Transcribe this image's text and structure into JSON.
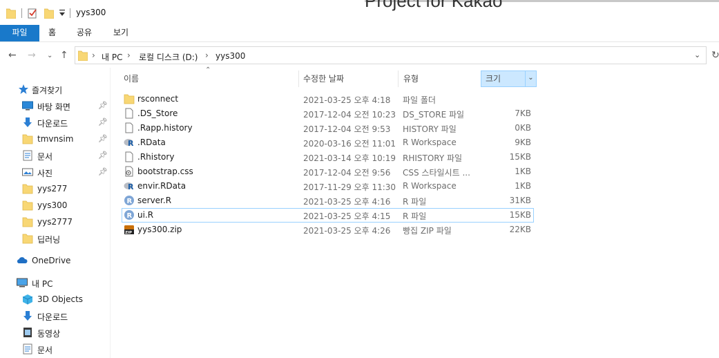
{
  "window": {
    "title": "yys300",
    "background_text": "Project for Kakao"
  },
  "ribbon": {
    "tabs": [
      "파일",
      "홈",
      "공유",
      "보기"
    ]
  },
  "address": {
    "crumbs": [
      "내 PC",
      "로컬 디스크 (D:)",
      "yys300"
    ]
  },
  "sidebar": {
    "quick_access": "즐겨찾기",
    "items": [
      {
        "label": "바탕 화면",
        "icon": "desktop-icon",
        "pinned": true
      },
      {
        "label": "다운로드",
        "icon": "download-icon",
        "pinned": true
      },
      {
        "label": "tmvnsim",
        "icon": "folder-icon",
        "pinned": true
      },
      {
        "label": "문서",
        "icon": "documents-icon",
        "pinned": true
      },
      {
        "label": "사진",
        "icon": "pictures-icon",
        "pinned": true
      },
      {
        "label": "yys277",
        "icon": "folder-icon",
        "pinned": false
      },
      {
        "label": "yys300",
        "icon": "folder-icon",
        "pinned": false
      },
      {
        "label": "yys2777",
        "icon": "folder-icon",
        "pinned": false
      },
      {
        "label": "딥러닝",
        "icon": "folder-icon",
        "pinned": false
      }
    ],
    "onedrive": "OneDrive",
    "this_pc": "내 PC",
    "pc_items": [
      {
        "label": "3D Objects",
        "icon": "3d-objects-icon"
      },
      {
        "label": "다운로드",
        "icon": "download-icon"
      },
      {
        "label": "동영상",
        "icon": "videos-icon"
      },
      {
        "label": "문서",
        "icon": "documents-icon"
      }
    ]
  },
  "columns": {
    "name": "이름",
    "date": "수정한 날짜",
    "type": "유형",
    "size": "크기"
  },
  "files": [
    {
      "name": "rsconnect",
      "date": "2021-03-25 오후 4:18",
      "type": "파일 폴더",
      "size": "",
      "icon": "folder-icon"
    },
    {
      "name": ".DS_Store",
      "date": "2017-12-04 오전 10:23",
      "type": "DS_STORE 파일",
      "size": "7KB",
      "icon": "file-icon"
    },
    {
      "name": ".Rapp.history",
      "date": "2017-12-04 오전 9:53",
      "type": "HISTORY 파일",
      "size": "0KB",
      "icon": "file-icon"
    },
    {
      "name": ".RData",
      "date": "2020-03-16 오전 11:01",
      "type": "R Workspace",
      "size": "9KB",
      "icon": "r-workspace-icon"
    },
    {
      "name": ".Rhistory",
      "date": "2021-03-14 오후 10:19",
      "type": "RHISTORY 파일",
      "size": "15KB",
      "icon": "file-icon"
    },
    {
      "name": "bootstrap.css",
      "date": "2017-12-04 오전 9:56",
      "type": "CSS 스타일시트 ...",
      "size": "1KB",
      "icon": "css-file-icon"
    },
    {
      "name": "envir.RData",
      "date": "2017-11-29 오후 11:30",
      "type": "R Workspace",
      "size": "1KB",
      "icon": "r-workspace-icon"
    },
    {
      "name": "server.R",
      "date": "2021-03-25 오후 4:16",
      "type": "R 파일",
      "size": "31KB",
      "icon": "r-file-icon"
    },
    {
      "name": "ui.R",
      "date": "2021-03-25 오후 4:15",
      "type": "R 파일",
      "size": "15KB",
      "icon": "r-file-icon",
      "selected": true
    },
    {
      "name": "yys300.zip",
      "date": "2021-03-25 오후 4:26",
      "type": "빵집 ZIP 파일",
      "size": "22KB",
      "icon": "zip-file-icon"
    }
  ],
  "colors": {
    "accent": "#1979ca",
    "folder": "#f8d775",
    "selection_border": "#99d1ff",
    "header_highlight": "#cce8ff"
  }
}
